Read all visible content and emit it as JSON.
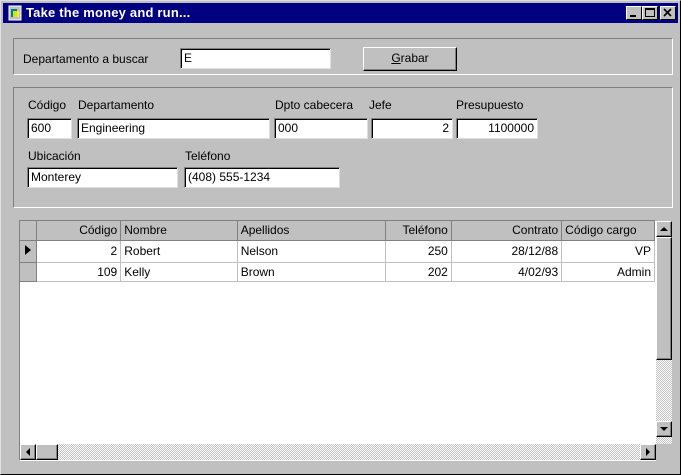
{
  "window": {
    "title": "Take the money and run..."
  },
  "search": {
    "label": "Departamento a buscar",
    "value": "E",
    "save_label": "Grabar",
    "save_mnemonic": "G",
    "save_rest": "rabar"
  },
  "detail": {
    "codigo_label": "Código",
    "codigo_value": "600",
    "departamento_label": "Departamento",
    "departamento_value": "Engineering",
    "cabecera_label": "Dpto cabecera",
    "cabecera_value": "000",
    "jefe_label": "Jefe",
    "jefe_value": "2",
    "presupuesto_label": "Presupuesto",
    "presupuesto_value": "1100000",
    "ubicacion_label": "Ubicación",
    "ubicacion_value": "Monterey",
    "telefono_label": "Teléfono",
    "telefono_value": "(408) 555-1234"
  },
  "grid": {
    "columns": [
      "Código",
      "Nombre",
      "Apellidos",
      "Teléfono",
      "Contrato",
      "Código cargo"
    ],
    "rows": [
      [
        "2",
        "Robert",
        "Nelson",
        "250",
        "28/12/88",
        "VP"
      ],
      [
        "109",
        "Kelly",
        "Brown",
        "202",
        "4/02/93",
        "Admin"
      ]
    ],
    "current_row": 0
  },
  "icons": {
    "app": "app-icon",
    "minimize": "minimize-icon",
    "maximize": "maximize-icon",
    "close": "close-icon"
  }
}
